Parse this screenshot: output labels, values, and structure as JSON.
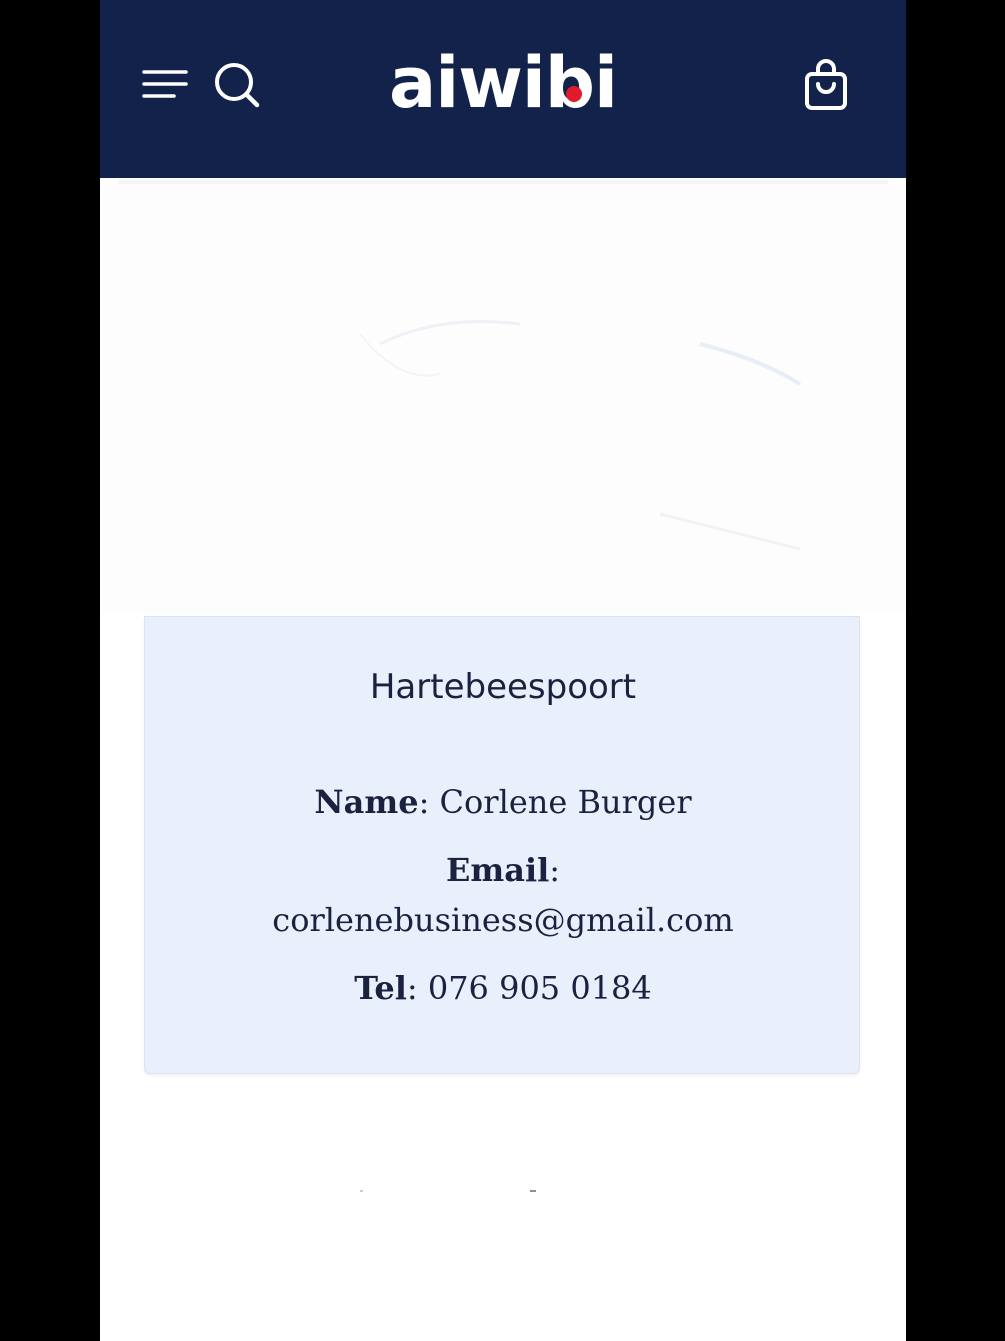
{
  "header": {
    "logo_text": "aiwibi",
    "brand_color": "#13224a",
    "logo_accent_color": "#e21b2c",
    "icons": [
      "menu-icon",
      "search-icon",
      "cart-icon"
    ]
  },
  "contact_card": {
    "title": "Hartebeespoort",
    "name_label": "Name",
    "name_value": "Corlene Burger",
    "email_label": "Email",
    "email_value": "corlenebusiness@gmail.com",
    "tel_label": "Tel",
    "tel_value": "076 905 0184",
    "separator": ":",
    "background_color": "#e9f0fc"
  }
}
